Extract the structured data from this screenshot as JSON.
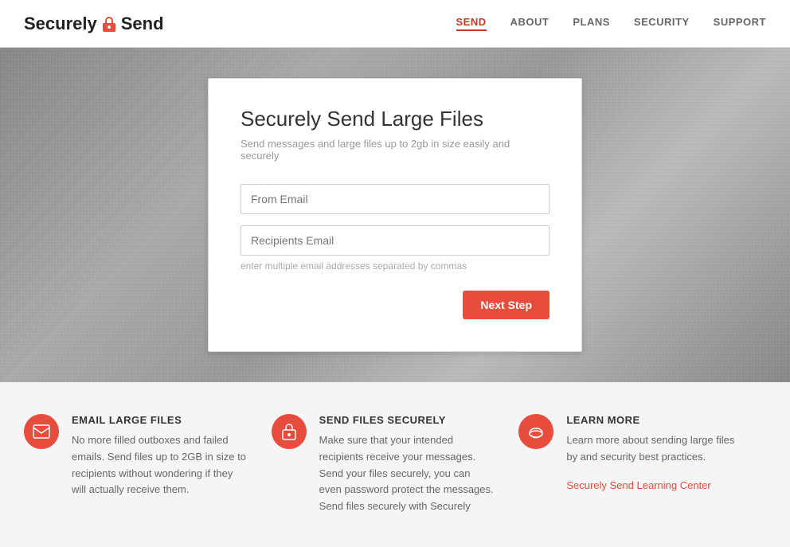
{
  "header": {
    "brand": "SecurelySend",
    "brand_part1": "Securely",
    "brand_part2": "Send",
    "nav": [
      {
        "label": "SEND",
        "active": true
      },
      {
        "label": "ABOUT",
        "active": false
      },
      {
        "label": "PLANS",
        "active": false
      },
      {
        "label": "SECURITY",
        "active": false
      },
      {
        "label": "SUPPORT",
        "active": false
      }
    ]
  },
  "hero": {
    "card": {
      "title": "Securely Send Large Files",
      "subtitle": "Send messages and large files up to 2gb in size easily and securely",
      "from_email_placeholder": "From Email",
      "recipients_email_placeholder": "Recipients Email",
      "hint": "enter multiple email addresses separated by commas",
      "next_step_label": "Next Step"
    }
  },
  "features": [
    {
      "icon": "email",
      "icon_unicode": "✉",
      "title": "EMAIL LARGE FILES",
      "body": "No more filled outboxes and failed emails. Send files up to 2GB in size to recipients without wondering if they will actually receive them."
    },
    {
      "icon": "lock",
      "icon_unicode": "🔒",
      "title": "SEND FILES SECURELY",
      "body": "Make sure that your intended recipients receive your messages. Send your files securely, you can even password protect the messages. Send files securely with Securely"
    },
    {
      "icon": "cloud",
      "icon_unicode": "☁",
      "title": "LEARN MORE",
      "body": "Learn more about sending large files by and security best practices.",
      "link_label": "Securely Send Learning Center",
      "link_href": "#"
    }
  ]
}
